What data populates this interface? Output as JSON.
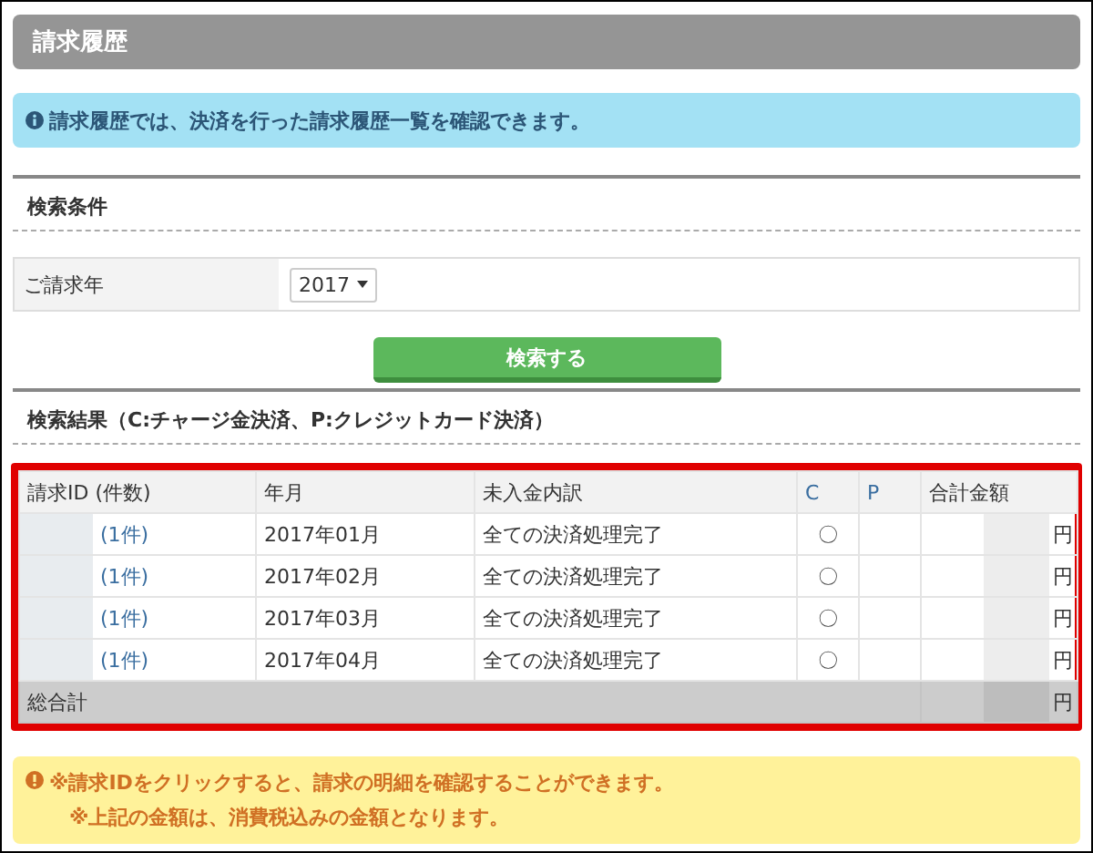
{
  "title": "請求履歴",
  "info": "請求履歴では、決済を行った請求履歴一覧を確認できます。",
  "search": {
    "section_title": "検索条件",
    "field": {
      "label": "ご請求年",
      "value": "2017"
    },
    "button": "検索する"
  },
  "results": {
    "section_title": "検索結果（C:チャージ金決済、P:クレジットカード決済）",
    "columns": [
      "請求ID (件数)",
      "年月",
      "未入金内訳",
      "C",
      "P",
      "合計金額"
    ],
    "rows": [
      {
        "count": "(1件)",
        "month": "2017年01月",
        "status": "全ての決済処理完了",
        "c": "〇",
        "p": "",
        "unit": "円"
      },
      {
        "count": "(1件)",
        "month": "2017年02月",
        "status": "全ての決済処理完了",
        "c": "〇",
        "p": "",
        "unit": "円"
      },
      {
        "count": "(1件)",
        "month": "2017年03月",
        "status": "全ての決済処理完了",
        "c": "〇",
        "p": "",
        "unit": "円"
      },
      {
        "count": "(1件)",
        "month": "2017年04月",
        "status": "全ての決済処理完了",
        "c": "〇",
        "p": "",
        "unit": "円"
      }
    ],
    "total": {
      "label": "総合計",
      "unit": "円"
    }
  },
  "notes": [
    "※請求IDをクリックすると、請求の明細を確認することができます。",
    "※上記の金額は、消費税込みの金額となります。"
  ]
}
